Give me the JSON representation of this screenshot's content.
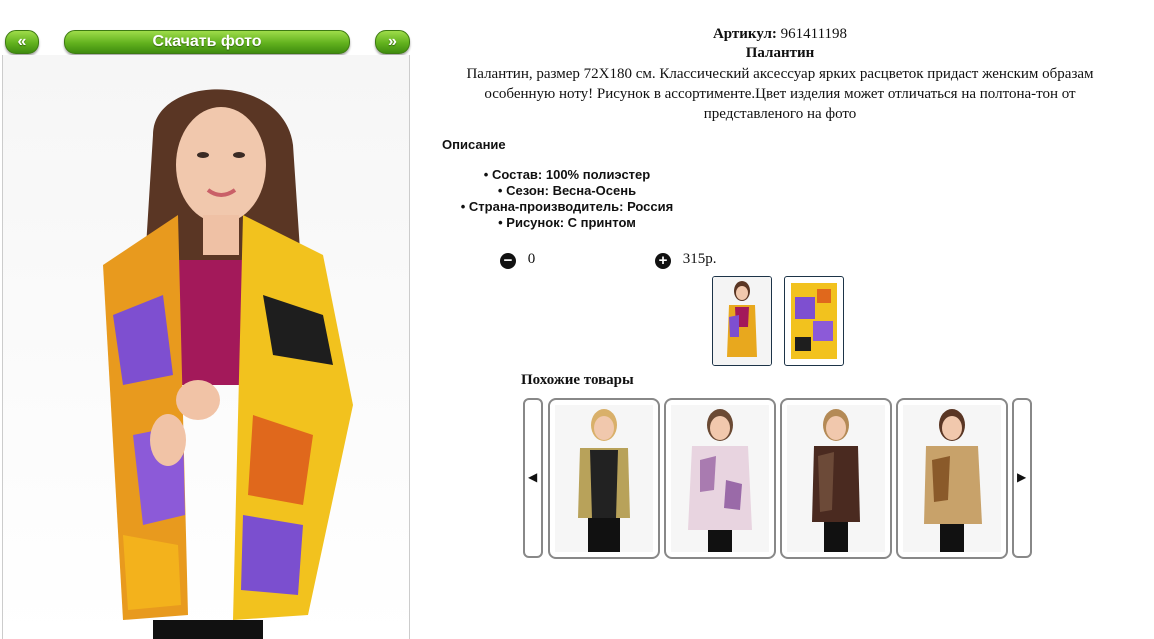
{
  "nav": {
    "prev_label": "«",
    "download_label": "Скачать фото",
    "next_label": "»"
  },
  "product": {
    "article_label": "Артикул:",
    "article_value": "961411198",
    "name": "Палантин",
    "description": "Палантин, размер 72Х180 см. Классический аксессуар ярких расцветок придаст женским образам особенную ноту! Рисунок в ассортименте.Цвет изделия может отличаться на полтона-тон от представленого на фото"
  },
  "specs": {
    "heading": "Описание",
    "items": [
      "Состав: 100% полиэстер",
      "Сезон: Весна-Осень",
      "Страна-производитель: Россия",
      "Рисунок: С принтом"
    ]
  },
  "order": {
    "quantity": "0",
    "price": "315р."
  },
  "similar": {
    "title": "Похожие товары",
    "prev_icon": "◀",
    "next_icon": "▶"
  },
  "colors": {
    "button_green": "#62b21e",
    "thumb_border": "#1d3448",
    "card_border": "#888888"
  }
}
